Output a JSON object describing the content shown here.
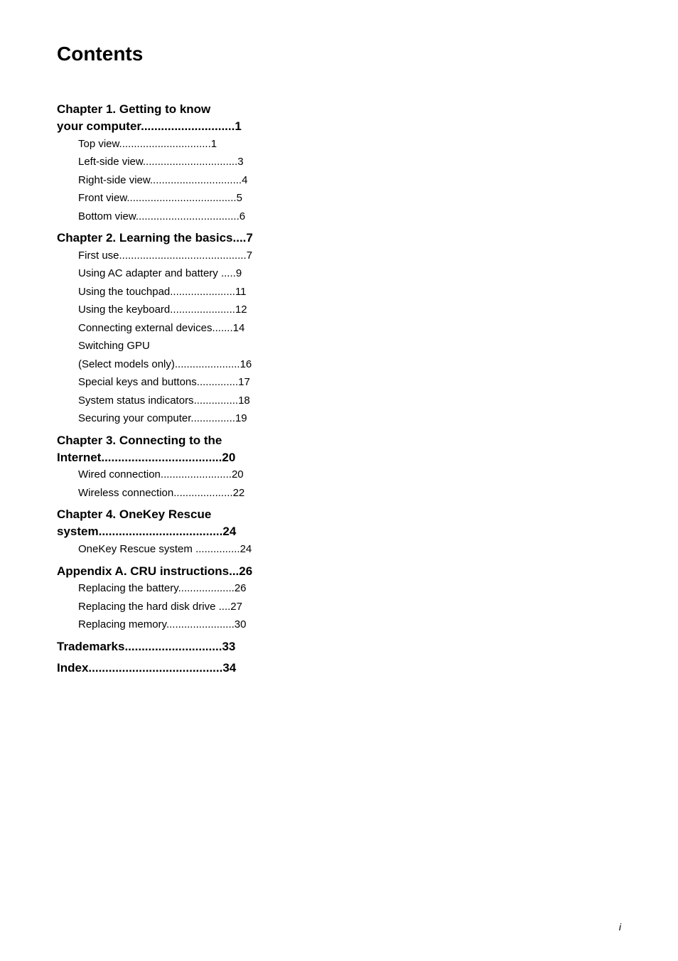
{
  "page": {
    "title": "Contents",
    "page_indicator": "i"
  },
  "chapters": [
    {
      "id": "ch1",
      "heading_line1": "Chapter 1. Getting to know",
      "heading_line2": "your computer",
      "heading_page": "1",
      "heading_dots": "............................",
      "entries": [
        {
          "label": "Top view",
          "dots": "...............................",
          "page": "1"
        },
        {
          "label": "Left-side view",
          "dots": "................................",
          "page": "3"
        },
        {
          "label": "Right-side view",
          "dots": "...............................",
          "page": "4"
        },
        {
          "label": "Front view",
          "dots": ".....................................",
          "page": "5"
        },
        {
          "label": "Bottom view",
          "dots": "...................................",
          "page": "6"
        }
      ]
    },
    {
      "id": "ch2",
      "heading_line1": "Chapter 2. Learning the basics",
      "heading_line2": null,
      "heading_page": "7",
      "heading_dots": "....",
      "entries": [
        {
          "label": "First use",
          "dots": "...........................................",
          "page": "7"
        },
        {
          "label": "Using AC adapter and battery",
          "dots": " .....",
          "page": "9"
        },
        {
          "label": "Using the touchpad",
          "dots": "......................",
          "page": "11"
        },
        {
          "label": "Using the keyboard",
          "dots": "......................",
          "page": "12"
        },
        {
          "label": "Connecting external devices",
          "dots": ".......",
          "page": "14"
        },
        {
          "label": "Switching GPU",
          "dots": "",
          "page": ""
        },
        {
          "label": "(Select models only)",
          "dots": "......................",
          "page": "16"
        },
        {
          "label": "Special keys and buttons",
          "dots": "..............",
          "page": "17"
        },
        {
          "label": "System status indicators",
          "dots": "...............",
          "page": "18"
        },
        {
          "label": "Securing your computer",
          "dots": "...............",
          "page": "19"
        }
      ]
    },
    {
      "id": "ch3",
      "heading_line1": "Chapter 3. Connecting to the",
      "heading_line2": "Internet",
      "heading_page": "20",
      "heading_dots": "....................................",
      "entries": [
        {
          "label": "Wired connection",
          "dots": "........................",
          "page": "20"
        },
        {
          "label": "Wireless connection",
          "dots": "....................",
          "page": "22"
        }
      ]
    },
    {
      "id": "ch4",
      "heading_line1": "Chapter 4. OneKey Rescue",
      "heading_line2": "system",
      "heading_page": "24",
      "heading_dots": ".....................................",
      "entries": [
        {
          "label": "OneKey Rescue system",
          "dots": " ...............",
          "page": "24"
        }
      ]
    },
    {
      "id": "appendixA",
      "heading_line1": "Appendix A. CRU instructions",
      "heading_line2": null,
      "heading_page": "26",
      "heading_dots": "...",
      "entries": [
        {
          "label": "Replacing the battery",
          "dots": "...................",
          "page": "26"
        },
        {
          "label": "Replacing the hard disk drive",
          "dots": " ....",
          "page": "27"
        },
        {
          "label": "Replacing memory",
          "dots": ".......................",
          "page": "30"
        }
      ]
    },
    {
      "id": "trademarks",
      "heading_line1": "Trademarks",
      "heading_line2": null,
      "heading_page": "33",
      "heading_dots": ".............................",
      "entries": []
    },
    {
      "id": "index",
      "heading_line1": "Index",
      "heading_line2": null,
      "heading_page": "34",
      "heading_dots": "........................................",
      "entries": []
    }
  ]
}
